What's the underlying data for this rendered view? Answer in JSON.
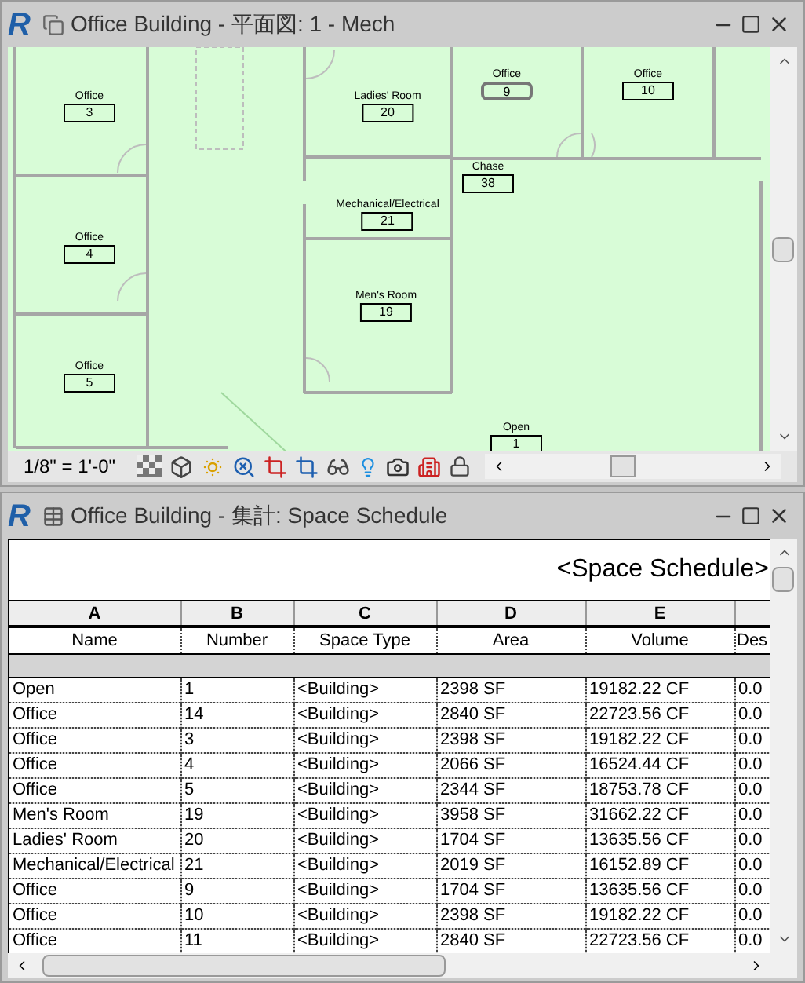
{
  "plan_window": {
    "logo": "R",
    "title": "Office Building - 平面図: 1 - Mech",
    "scale": "1/8\" = 1'-0\"",
    "rooms": [
      {
        "name": "Office",
        "number": "3",
        "selected": false
      },
      {
        "name": "Ladies' Room",
        "number": "20",
        "selected": false
      },
      {
        "name": "Office",
        "number": "9",
        "selected": true
      },
      {
        "name": "Office",
        "number": "10",
        "selected": false
      },
      {
        "name": "Chase",
        "number": "38",
        "selected": false
      },
      {
        "name": "Mechanical/Electrical",
        "number": "21",
        "selected": false
      },
      {
        "name": "Office",
        "number": "4",
        "selected": false
      },
      {
        "name": "Men's Room",
        "number": "19",
        "selected": false
      },
      {
        "name": "Office",
        "number": "5",
        "selected": false
      },
      {
        "name": "Open",
        "number": "1",
        "selected": false
      }
    ]
  },
  "schedule_window": {
    "logo": "R",
    "title": "Office Building - 集計: Space Schedule",
    "schedule_title": "<Space Schedule>",
    "columns": [
      {
        "letter": "A",
        "name": "Name"
      },
      {
        "letter": "B",
        "name": "Number"
      },
      {
        "letter": "C",
        "name": "Space Type"
      },
      {
        "letter": "D",
        "name": "Area"
      },
      {
        "letter": "E",
        "name": "Volume"
      },
      {
        "name": "Des"
      }
    ],
    "rows": [
      [
        "Open",
        "1",
        "<Building>",
        "2398 SF",
        "19182.22 CF",
        "0.0"
      ],
      [
        "Office",
        "14",
        "<Building>",
        "2840 SF",
        "22723.56 CF",
        "0.0"
      ],
      [
        "Office",
        "3",
        "<Building>",
        "2398 SF",
        "19182.22 CF",
        "0.0"
      ],
      [
        "Office",
        "4",
        "<Building>",
        "2066 SF",
        "16524.44 CF",
        "0.0"
      ],
      [
        "Office",
        "5",
        "<Building>",
        "2344 SF",
        "18753.78 CF",
        "0.0"
      ],
      [
        "Men's Room",
        "19",
        "<Building>",
        "3958 SF",
        "31662.22 CF",
        "0.0"
      ],
      [
        "Ladies' Room",
        "20",
        "<Building>",
        "1704 SF",
        "13635.56 CF",
        "0.0"
      ],
      [
        "Mechanical/Electrical",
        "21",
        "<Building>",
        "2019 SF",
        "16152.89 CF",
        "0.0"
      ],
      [
        "Office",
        "9",
        "<Building>",
        "1704 SF",
        "13635.56 CF",
        "0.0"
      ],
      [
        "Office",
        "10",
        "<Building>",
        "2398 SF",
        "19182.22 CF",
        "0.0"
      ],
      [
        "Office",
        "11",
        "<Building>",
        "2840 SF",
        "22723.56 CF",
        "0.0"
      ]
    ]
  }
}
